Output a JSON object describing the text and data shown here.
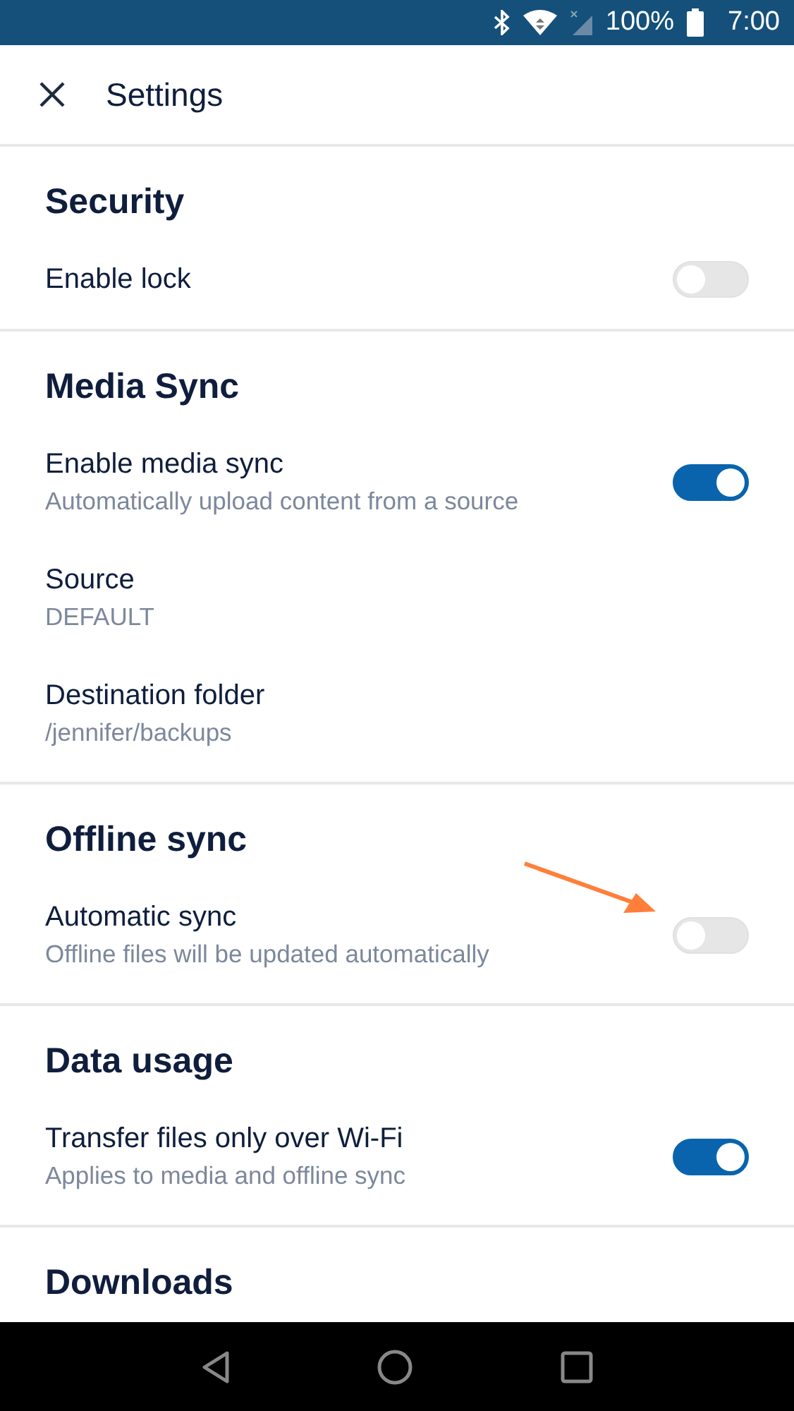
{
  "status_bar": {
    "battery": "100%",
    "time": "7:00"
  },
  "header": {
    "title": "Settings"
  },
  "sections": [
    {
      "title": "Security",
      "rows": [
        {
          "kind": "toggle",
          "title": "Enable lock",
          "on": false
        }
      ]
    },
    {
      "title": "Media Sync",
      "rows": [
        {
          "kind": "toggle",
          "title": "Enable media sync",
          "subtitle": "Automatically upload content from a source",
          "on": true
        },
        {
          "kind": "value",
          "title": "Source",
          "subtitle": "DEFAULT"
        },
        {
          "kind": "value",
          "title": "Destination folder",
          "subtitle": "/jennifer/backups"
        }
      ]
    },
    {
      "title": "Offline sync",
      "rows": [
        {
          "kind": "toggle",
          "title": "Automatic sync",
          "subtitle": "Offline files will be updated automatically",
          "on": false,
          "highlighted": true
        }
      ]
    },
    {
      "title": "Data usage",
      "rows": [
        {
          "kind": "toggle",
          "title": "Transfer files only over Wi-Fi",
          "subtitle": "Applies to media and offline sync",
          "on": true
        }
      ]
    },
    {
      "title": "Downloads"
    }
  ]
}
